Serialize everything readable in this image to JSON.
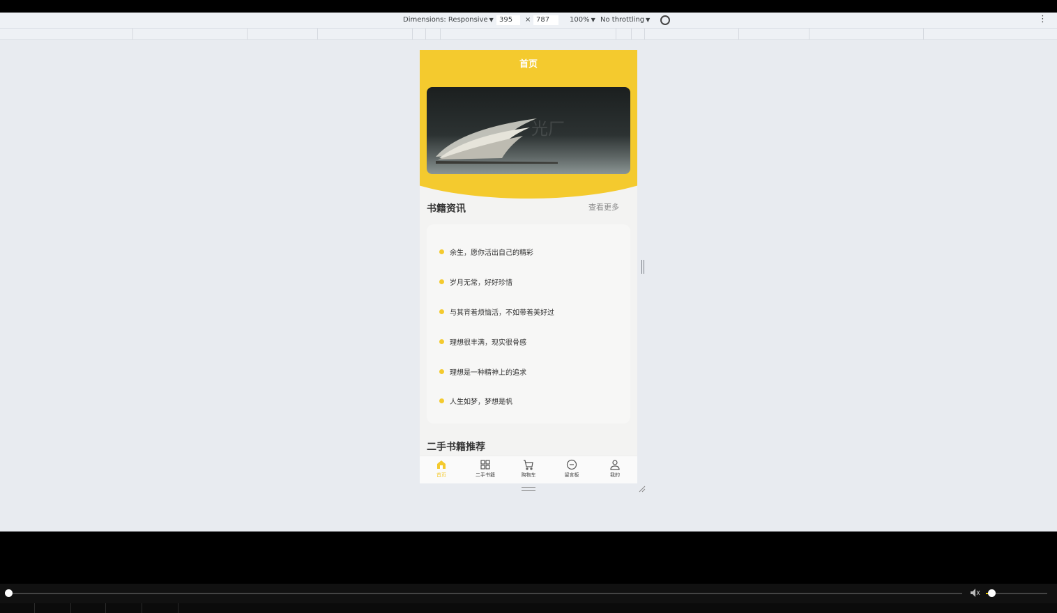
{
  "devtools": {
    "dimensions_label": "Dimensions: Responsive",
    "width": "395",
    "times": "×",
    "height": "787",
    "zoom": "100%",
    "throttling": "No throttling"
  },
  "page": {
    "title": "首页",
    "banner_watermark": "光厂",
    "news_section": {
      "title": "书籍资讯",
      "more_label": "查看更多",
      "items": [
        "余生，愿你活出自己的精彩",
        "岁月无常，好好珍惜",
        "与其背着烦恼活，不如带着美好过",
        "理想很丰满，现实很骨感",
        "理想是一种精神上的追求",
        "人生如梦，梦想是帆"
      ]
    },
    "second_section_title": "二手书籍推荐",
    "tabbar": [
      {
        "label": "首页",
        "icon": "home-icon",
        "active": true
      },
      {
        "label": "二手书籍",
        "icon": "grid-icon",
        "active": false
      },
      {
        "label": "购物车",
        "icon": "cart-icon",
        "active": false
      },
      {
        "label": "留言板",
        "icon": "message-icon",
        "active": false
      },
      {
        "label": "我的",
        "icon": "user-icon",
        "active": false
      }
    ]
  },
  "colors": {
    "accent": "#f4ca2e",
    "page_bg": "#f3f3f2"
  },
  "player": {
    "progress": 0.0,
    "volume": 0.05
  }
}
